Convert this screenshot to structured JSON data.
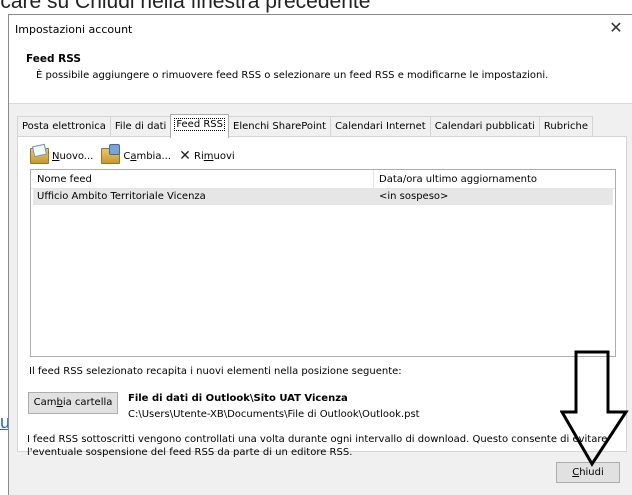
{
  "background": {
    "heading_text": "cliccare su Chiudi nella finestra precedente",
    "link_fragment": "u"
  },
  "dialog": {
    "title": "Impostazioni account",
    "close_glyph": "✕"
  },
  "header": {
    "title": "Feed RSS",
    "description": "È possibile aggiungere o rimuovere feed RSS o selezionare un feed RSS e modificarne le impostazioni."
  },
  "tabs": [
    {
      "label": "Posta elettronica",
      "active": false
    },
    {
      "label": "File di dati",
      "active": false
    },
    {
      "label": "Feed RSS",
      "active": true
    },
    {
      "label": "Elenchi SharePoint",
      "active": false
    },
    {
      "label": "Calendari Internet",
      "active": false
    },
    {
      "label": "Calendari pubblicati",
      "active": false
    },
    {
      "label": "Rubriche",
      "active": false
    }
  ],
  "toolbar": {
    "new_pre": "",
    "new_ul": "N",
    "new_post": "uovo...",
    "change_pre": "C",
    "change_ul": "a",
    "change_post": "mbia...",
    "remove_pre": "Ri",
    "remove_ul": "m",
    "remove_post": "uovi"
  },
  "list": {
    "columns": [
      "Nome feed",
      "Data/ora ultimo aggiornamento"
    ],
    "rows": [
      {
        "name": "Ufficio Ambito Territoriale Vicenza",
        "updated": "<in sospeso>"
      }
    ]
  },
  "delivery": {
    "text": "Il feed RSS selezionato recapita i nuovi elementi nella posizione seguente:",
    "button_pre": "Cam",
    "button_ul": "b",
    "button_post": "ia cartella",
    "folder_name": "File di dati di Outlook\\Sito UAT Vicenza",
    "folder_path": "C:\\Users\\Utente-XB\\Documents\\File di Outlook\\Outlook.pst"
  },
  "info_text": "I feed RSS sottoscritti vengono controllati una volta durante ogni intervallo di download. Questo consente di evitare l'eventuale sospensione del feed RSS da parte di un editore RSS.",
  "footer": {
    "close_ul": "C",
    "close_post": "hiudi"
  },
  "colors": {
    "dialog_bg": "#f0f0f0",
    "selected_row": "#e6e6e6",
    "link": "#2b62c6"
  }
}
